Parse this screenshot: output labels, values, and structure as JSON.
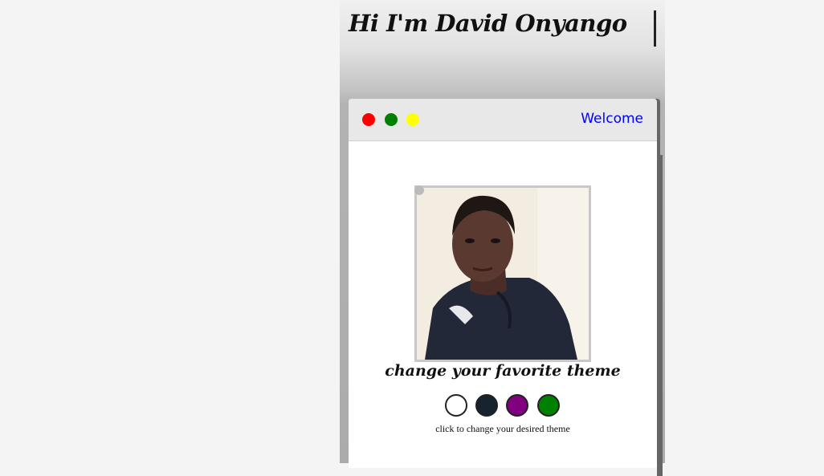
{
  "header": {
    "title": "Hi I'm David Onyango"
  },
  "window": {
    "controls": [
      {
        "name": "close",
        "color": "#ff0000"
      },
      {
        "name": "minimize",
        "color": "#008000"
      },
      {
        "name": "maximize",
        "color": "#ffff00"
      }
    ],
    "nav_link": "Welcome"
  },
  "profile": {
    "photo_alt": "profile-photo"
  },
  "theme": {
    "heading": "change your favorite theme",
    "caption": "click to change your desired theme",
    "swatches": [
      {
        "name": "light",
        "color": "#ffffff"
      },
      {
        "name": "dark",
        "color": "#17232f"
      },
      {
        "name": "purple",
        "color": "#800080"
      },
      {
        "name": "green",
        "color": "#008000"
      }
    ]
  }
}
